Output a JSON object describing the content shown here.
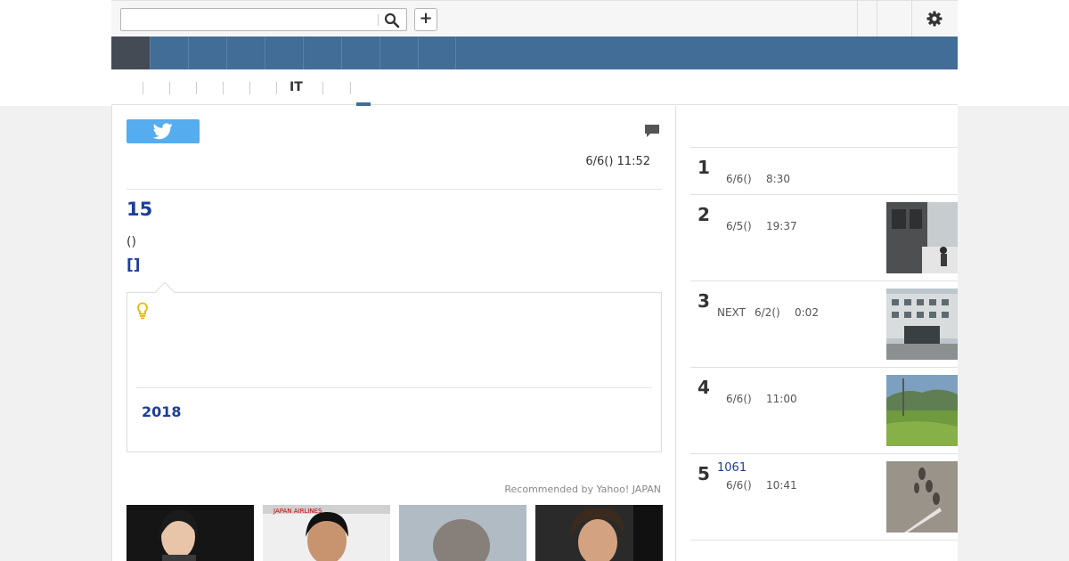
{
  "search": {
    "value": "",
    "placeholder": ""
  },
  "toolbar": {
    "add_label": "+"
  },
  "subnav": {
    "active_label": "IT"
  },
  "article": {
    "date": "6/6() 11:52",
    "headline": "15",
    "byline": "()",
    "source_link": "[]",
    "tip_year": "2018",
    "recommended": "Recommended by Yahoo! JAPAN"
  },
  "ranking": [
    {
      "num": "1",
      "title": "",
      "prefix": "",
      "date": "6/6()",
      "time": "8:30"
    },
    {
      "num": "2",
      "title": "",
      "prefix": "",
      "date": "6/5()",
      "time": "19:37"
    },
    {
      "num": "3",
      "title": "",
      "prefix": "NEXT",
      "date": "6/2()",
      "time": "0:02"
    },
    {
      "num": "4",
      "title": "",
      "prefix": "",
      "date": "6/6()",
      "time": "11:00"
    },
    {
      "num": "5",
      "title": "1061",
      "prefix": "",
      "date": "6/6()",
      "time": "10:41"
    }
  ],
  "colors": {
    "nav": "#426d96",
    "nav_active": "#444b54",
    "link": "#1a3f9b",
    "twitter": "#55acee"
  }
}
